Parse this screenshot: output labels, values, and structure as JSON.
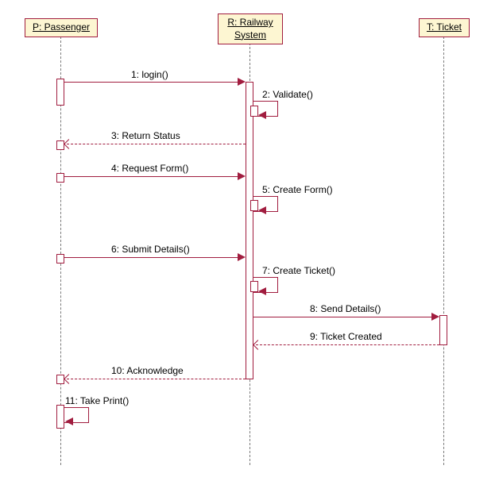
{
  "diagram_type": "UML Sequence Diagram",
  "participants": {
    "p": "P: Passenger",
    "r_line1": "R: Railway",
    "r_line2": "System",
    "t": "T: Ticket"
  },
  "messages": {
    "m1": "1: login()",
    "m2": "2: Validate()",
    "m3": "3: Return Status",
    "m4": "4: Request Form()",
    "m5": "5: Create Form()",
    "m6": "6: Submit Details()",
    "m7": "7: Create Ticket()",
    "m8": "8: Send Details()",
    "m9": "9: Ticket Created",
    "m10": "10: Acknowledge",
    "m11": "11: Take Print()"
  },
  "chart_data": {
    "type": "sequence-diagram",
    "participants": [
      {
        "id": "P",
        "name": "Passenger"
      },
      {
        "id": "R",
        "name": "Railway System"
      },
      {
        "id": "T",
        "name": "Ticket"
      }
    ],
    "interactions": [
      {
        "seq": 1,
        "from": "P",
        "to": "R",
        "label": "login()",
        "style": "call"
      },
      {
        "seq": 2,
        "from": "R",
        "to": "R",
        "label": "Validate()",
        "style": "self-call"
      },
      {
        "seq": 3,
        "from": "R",
        "to": "P",
        "label": "Return Status",
        "style": "return"
      },
      {
        "seq": 4,
        "from": "P",
        "to": "R",
        "label": "Request Form()",
        "style": "call"
      },
      {
        "seq": 5,
        "from": "R",
        "to": "R",
        "label": "Create Form()",
        "style": "self-call"
      },
      {
        "seq": 6,
        "from": "P",
        "to": "R",
        "label": "Submit Details()",
        "style": "call"
      },
      {
        "seq": 7,
        "from": "R",
        "to": "R",
        "label": "Create Ticket()",
        "style": "self-call"
      },
      {
        "seq": 8,
        "from": "R",
        "to": "T",
        "label": "Send Details()",
        "style": "call"
      },
      {
        "seq": 9,
        "from": "T",
        "to": "R",
        "label": "Ticket Created",
        "style": "return"
      },
      {
        "seq": 10,
        "from": "R",
        "to": "P",
        "label": "Acknowledge",
        "style": "return"
      },
      {
        "seq": 11,
        "from": "P",
        "to": "P",
        "label": "Take Print()",
        "style": "self-call"
      }
    ]
  }
}
